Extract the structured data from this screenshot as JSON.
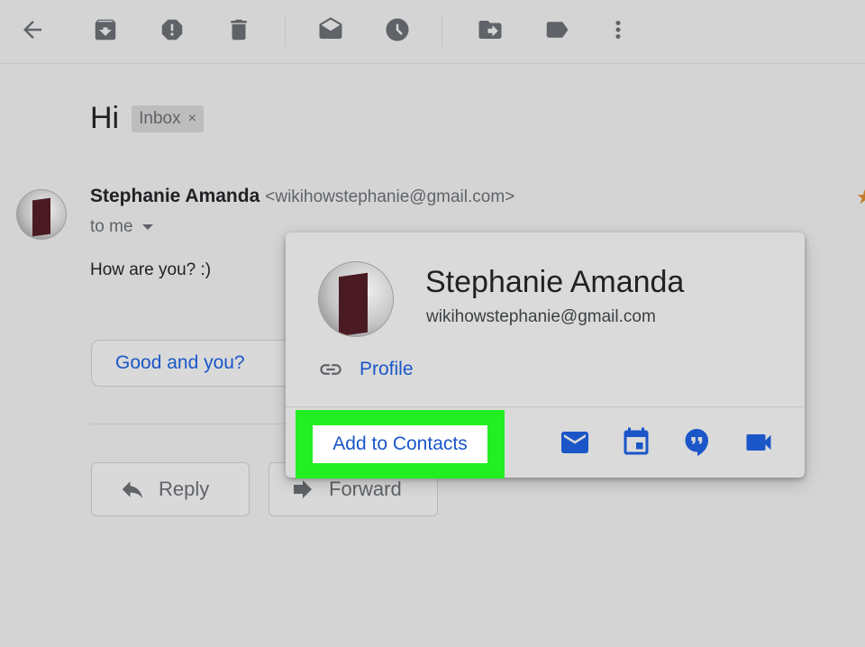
{
  "toolbar": {
    "icons": [
      "back-arrow-icon",
      "archive-icon",
      "report-spam-icon",
      "delete-icon",
      "mark-unread-icon",
      "snooze-icon",
      "move-to-icon",
      "label-icon",
      "more-vert-icon"
    ]
  },
  "email": {
    "subject": "Hi",
    "label": "Inbox",
    "label_remove": "×",
    "sender_name": "Stephanie Amanda",
    "sender_email": "<wikihowstephanie@gmail.com>",
    "recipient": "to me",
    "body": "How are you? :)",
    "smart_reply": "Good and you?",
    "reply_label": "Reply",
    "forward_label": "Forward"
  },
  "contact_card": {
    "name": "Stephanie Amanda",
    "email": "wikihowstephanie@gmail.com",
    "profile_link": "Profile",
    "add_to_contacts": "Add to Contacts",
    "highlight_color": "#22ee22",
    "actions": [
      "email-icon",
      "calendar-icon",
      "hangouts-icon",
      "video-call-icon"
    ]
  },
  "colors": {
    "accent": "#1a56c8",
    "background": "#d4d4d4",
    "icon_gray": "#5f6368"
  }
}
